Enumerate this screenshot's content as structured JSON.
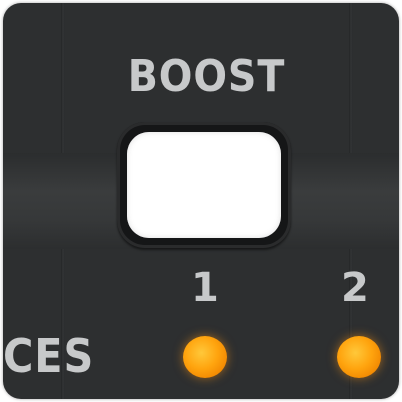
{
  "panel": {
    "boost_label": "BOOST",
    "partial_label": "CES",
    "channels": [
      {
        "number": "1",
        "led_color": "#ffa40e",
        "led_state": "on"
      },
      {
        "number": "2",
        "led_color": "#ffa40e",
        "led_state": "on"
      }
    ],
    "colors": {
      "panel_background": "#2d2f30",
      "label_text": "#c7c9ca",
      "button_face": "#ffffff"
    }
  }
}
